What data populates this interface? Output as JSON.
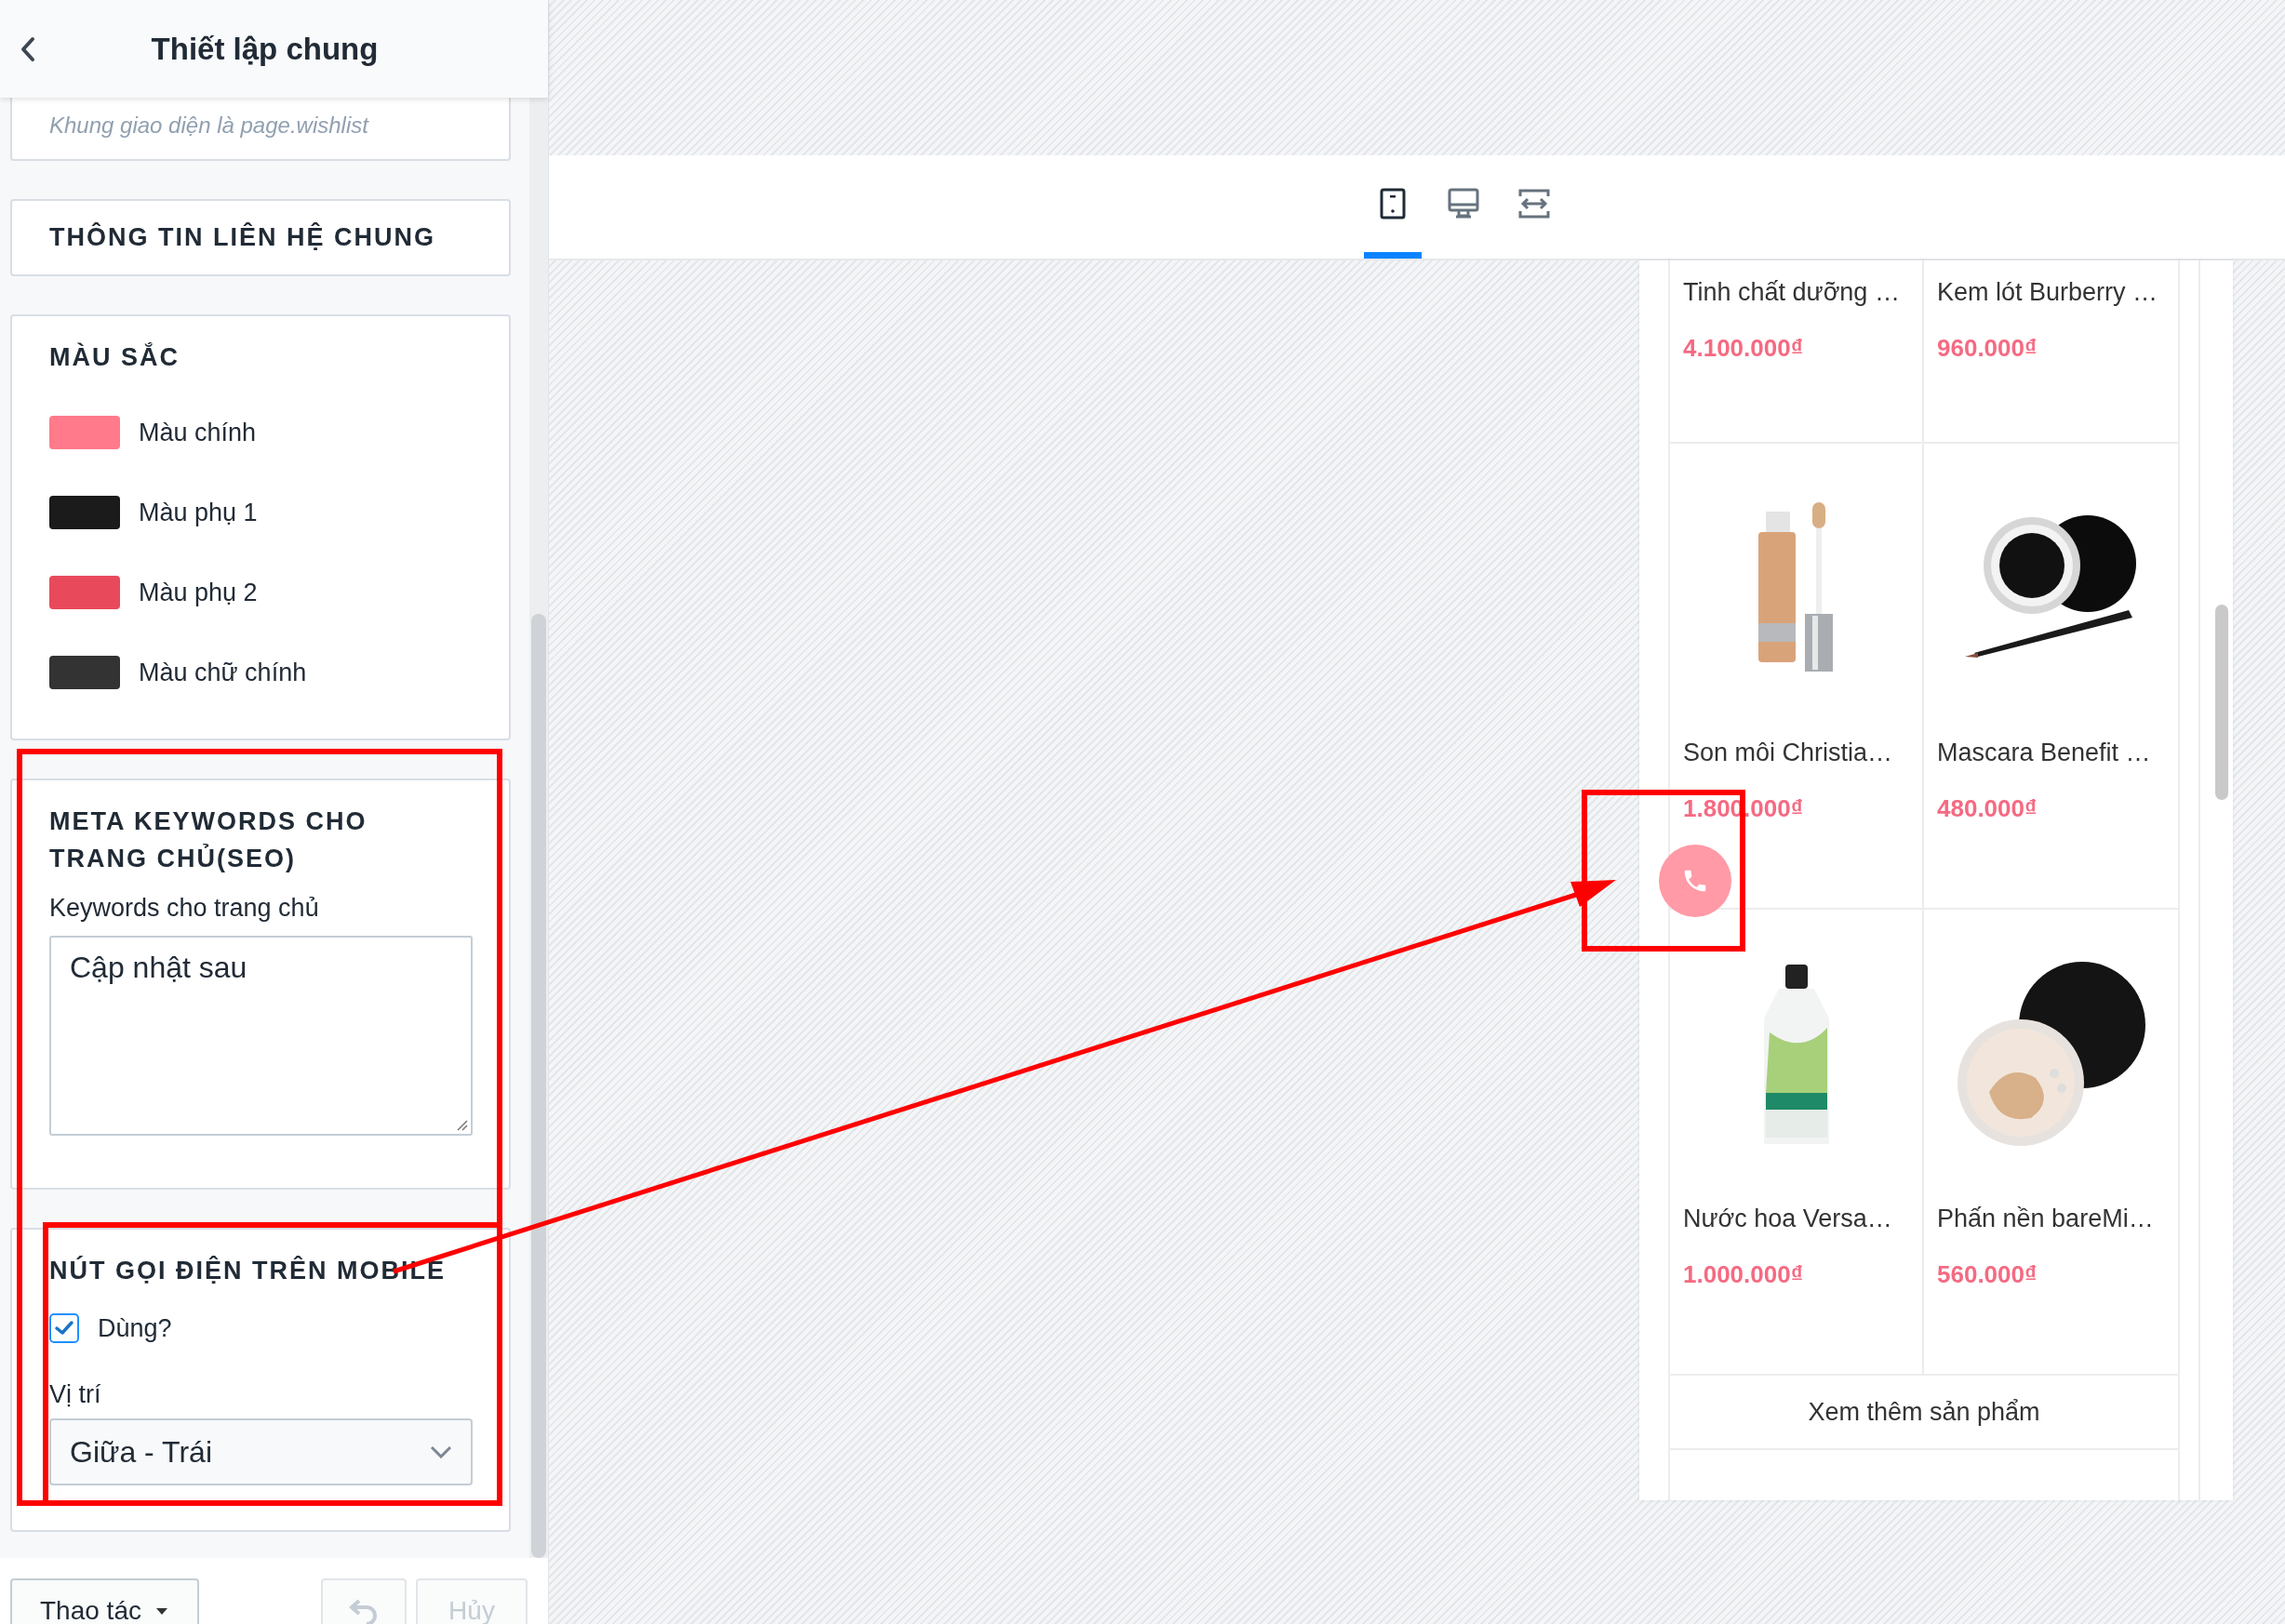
{
  "header": {
    "title": "Thiết lập chung"
  },
  "sections": [
    {
      "kind": "note",
      "text": "Khung giao diện là page.wishlist"
    },
    {
      "kind": "collapsed",
      "title": "THÔNG TIN LIÊN HỆ CHUNG"
    },
    {
      "kind": "colors",
      "title": "MÀU SẮC",
      "colors": [
        {
          "label": "Màu chính",
          "color": "#ff7a8a"
        },
        {
          "label": "Màu phụ 1",
          "color": "#1b1b1b"
        },
        {
          "label": "Màu phụ 2",
          "color": "#e84a5b"
        },
        {
          "label": "Màu chữ chính",
          "color": "#333333"
        }
      ]
    },
    {
      "kind": "textarea",
      "title": "META KEYWORDS CHO TRANG CHỦ(SEO)",
      "label": "Keywords cho trang chủ",
      "value": "Cập nhật sau"
    },
    {
      "kind": "call",
      "title": "NÚT GỌI ĐIỆN TRÊN MOBILE",
      "checkbox": {
        "label": "Dùng?",
        "checked": true
      },
      "select_label": "Vị trí",
      "select_value": "Giữa - Trái"
    }
  ],
  "footer": {
    "actions_button": {
      "label": "Thao tác"
    },
    "undo_button": {
      "disabled": true
    },
    "cancel_button": {
      "label": "Hủy",
      "disabled": true
    }
  },
  "device_tabs": [
    {
      "kind": "mobile",
      "selected": true
    },
    {
      "kind": "desktop",
      "selected": false
    },
    {
      "kind": "fullwidth",
      "selected": false
    }
  ],
  "products": [
    {
      "name": "Tinh chất dưỡng …",
      "price": "4.100.000₫"
    },
    {
      "name": "Kem lót Burberry …",
      "price": "960.000₫"
    },
    {
      "name": "Son môi Christia…",
      "price": "1.800.000₫"
    },
    {
      "name": "Mascara Benefit …",
      "price": "480.000₫"
    },
    {
      "name": "Nước hoa Versa…",
      "price": "1.000.000₫"
    },
    {
      "name": "Phấn nền bareMi…",
      "price": "560.000₫"
    }
  ],
  "more_button": "Xem thêm sản phẩm"
}
